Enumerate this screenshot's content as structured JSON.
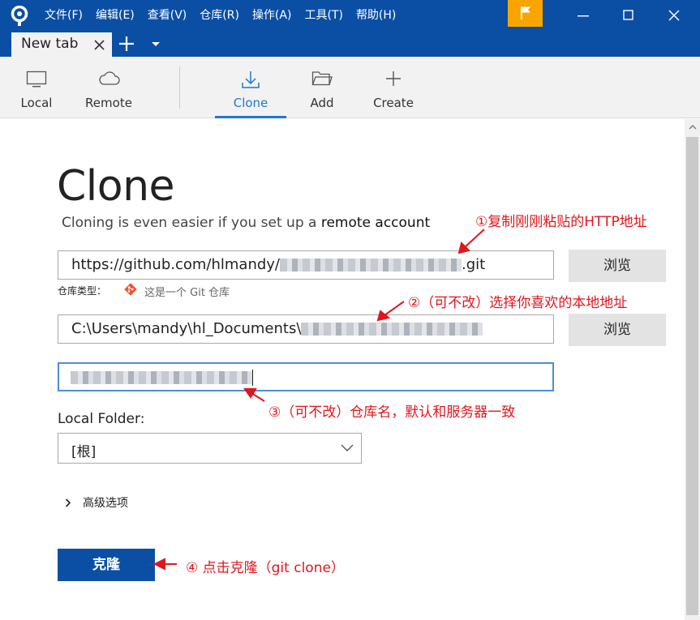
{
  "menu": [
    "文件(F)",
    "编辑(E)",
    "查看(V)",
    "仓库(R)",
    "操作(A)",
    "工具(T)",
    "帮助(H)"
  ],
  "tab": {
    "label": "New tab"
  },
  "toolbar": {
    "local": "Local",
    "remote": "Remote",
    "clone": "Clone",
    "add": "Add",
    "create": "Create"
  },
  "page": {
    "title": "Clone",
    "subtitle_prefix": "Cloning is even easier if you set up a ",
    "subtitle_link": "remote account"
  },
  "source_url": {
    "prefix": "https://github.com/hlmandy/",
    "suffix": ".git"
  },
  "browse_label": "浏览",
  "repo_type": {
    "label": "仓库类型：",
    "value": "这是一个 Git 仓库"
  },
  "dest_path": {
    "prefix": "C:\\Users\\mandy\\hl_Documents\\"
  },
  "local_folder": {
    "label": "Local Folder:",
    "value": "[根]"
  },
  "advanced_label": "高级选项",
  "clone_button": "克隆",
  "annotations": {
    "a1": "①复制刚刚粘贴的HTTP地址",
    "a2": "②（可不改）选择你喜欢的本地地址",
    "a3": "③（可不改）仓库名，默认和服务器一致",
    "a4": "④ 点击克隆（git clone）"
  },
  "colors": {
    "titlebar": "#0b4fa5",
    "accent": "#1e78d2",
    "flag": "#f8a500",
    "annotation": "#e0161d",
    "git": "#f05133"
  }
}
